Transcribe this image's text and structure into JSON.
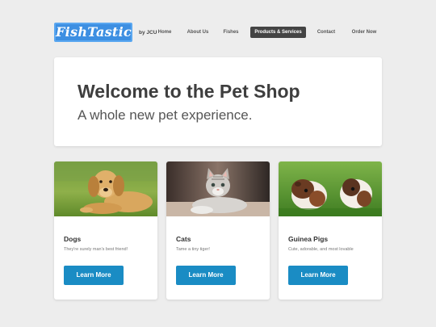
{
  "header": {
    "logo": "FishTastic",
    "byline": "by JCU",
    "nav": [
      {
        "label": "Home",
        "active": false
      },
      {
        "label": "About Us",
        "active": false
      },
      {
        "label": "Fishes",
        "active": false
      },
      {
        "label": "Products & Services",
        "active": true
      },
      {
        "label": "Contact",
        "active": false
      },
      {
        "label": "Order Now",
        "active": false
      }
    ]
  },
  "hero": {
    "title": "Welcome to the Pet Shop",
    "subtitle": "A whole new pet experience."
  },
  "cards": [
    {
      "title": "Dogs",
      "text": "They're surely man's best friend!",
      "button": "Learn More",
      "image": "puppy-photo"
    },
    {
      "title": "Cats",
      "text": "Tame a tiny tiger!",
      "button": "Learn More",
      "image": "kitten-photo"
    },
    {
      "title": "Guinea Pigs",
      "text": "Cute, adorable, and most lovable",
      "button": "Learn More",
      "image": "guinea-pigs-photo"
    }
  ],
  "colors": {
    "logo_bg": "#3d8fe2",
    "nav_active_bg": "#444444",
    "button_bg": "#1a8cc4",
    "page_bg": "#ededed"
  }
}
